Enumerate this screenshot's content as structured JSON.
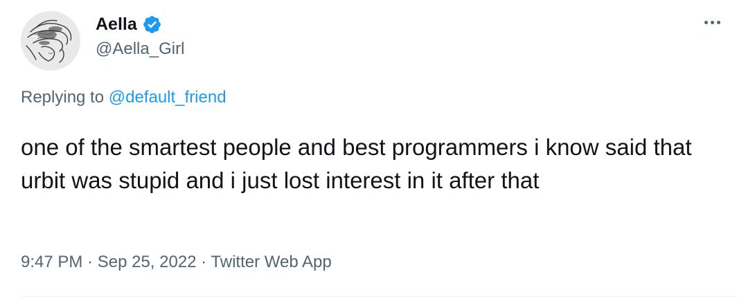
{
  "author": {
    "display_name": "Aella",
    "handle": "@Aella_Girl",
    "verified": true,
    "avatar_icon": "sketched-face-avatar"
  },
  "reply": {
    "prefix": "Replying to ",
    "to_handle": "@default_friend"
  },
  "tweet": {
    "text": "one of the smartest people and best programmers i know said that urbit was stupid and i just lost interest in it after that"
  },
  "meta": {
    "time": "9:47 PM",
    "separator": " · ",
    "date": "Sep 25, 2022",
    "source": "Twitter Web App"
  },
  "colors": {
    "text": "#0f1419",
    "muted": "#536471",
    "link": "#1d9bf0",
    "verified": "#1d9bf0"
  },
  "icons": {
    "verified": "verified-badge-icon",
    "more": "more-options-icon"
  }
}
